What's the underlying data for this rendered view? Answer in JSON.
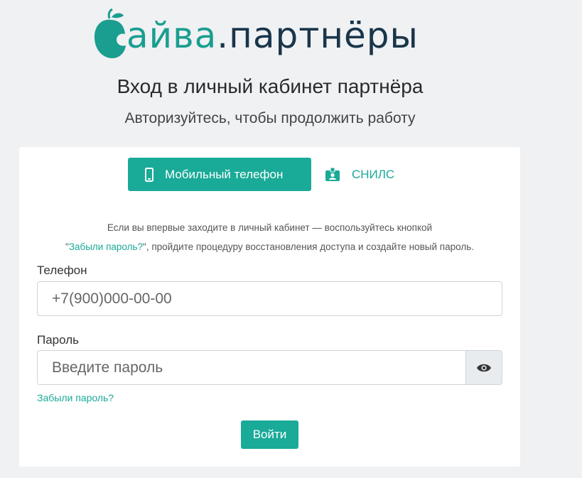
{
  "logo": {
    "part1": "айва",
    "part2": ".партнёры"
  },
  "heading": "Вход в личный кабинет партнёра",
  "subheading": "Авторизуйтесь, чтобы продолжить работу",
  "tabs": {
    "phone": {
      "label": "Мобильный телефон",
      "icon": "mobile-phone-icon"
    },
    "snils": {
      "label": "СНИЛС",
      "icon": "id-badge-icon"
    }
  },
  "info": {
    "line1": "Если вы впервые заходите в личный кабинет — воспользуйтесь кнопкой",
    "quote_open": "\"",
    "link": "Забыли пароль?",
    "line2_rest": "\", пройдите процедуру восстановления доступа и создайте новый пароль."
  },
  "phone_field": {
    "label": "Телефон",
    "placeholder": "+7(900)000-00-00",
    "value": ""
  },
  "password_field": {
    "label": "Пароль",
    "placeholder": "Введите пароль",
    "value": "",
    "toggle_icon": "eye-icon"
  },
  "forgot_link": "Забыли пароль?",
  "submit_label": "Войти",
  "colors": {
    "accent": "#1aaa98",
    "brand_dark": "#19354a",
    "background": "#f0f1f3"
  }
}
